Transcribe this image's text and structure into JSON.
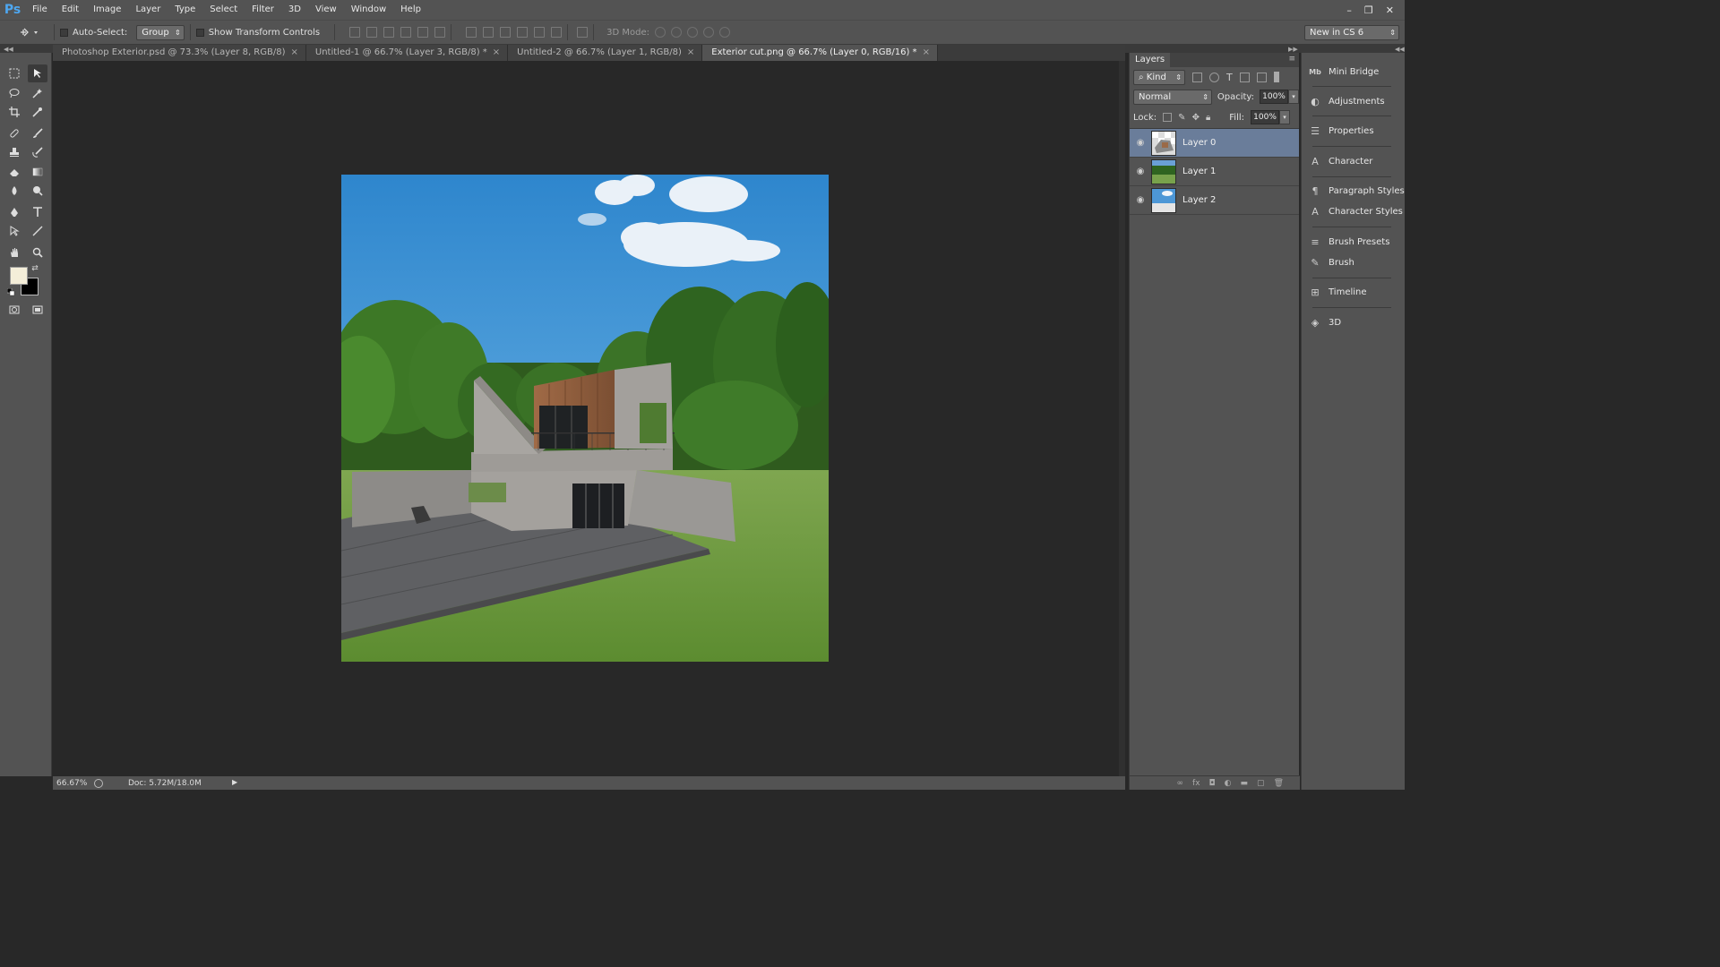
{
  "app": {
    "logo": "Ps",
    "menu": [
      "File",
      "Edit",
      "Image",
      "Layer",
      "Type",
      "Select",
      "Filter",
      "3D",
      "View",
      "Window",
      "Help"
    ],
    "window_controls": {
      "minimize": "–",
      "restore": "❐",
      "close": "✕"
    }
  },
  "options_bar": {
    "auto_select_label": "Auto-Select:",
    "auto_select_value": "Group",
    "show_transform_label": "Show Transform Controls",
    "mode_3d_label": "3D Mode:",
    "workspace": "New in CS 6"
  },
  "tabs": [
    {
      "label": "Photoshop Exterior.psd @ 73.3% (Layer 8, RGB/8)",
      "active": false
    },
    {
      "label": "Untitled-1 @ 66.7% (Layer 3, RGB/8) *",
      "active": false
    },
    {
      "label": "Untitled-2 @ 66.7% (Layer 1, RGB/8)",
      "active": false
    },
    {
      "label": "Exterior cut.png @ 66.7% (Layer 0, RGB/16) *",
      "active": true
    }
  ],
  "tab_close": "×",
  "status": {
    "zoom": "66.67%",
    "doc": "Doc: 5.72M/18.0M",
    "arrow": "▶"
  },
  "colors": {
    "foreground": "#f4eed9",
    "background": "#000000",
    "selected_layer": "#6a7d9a",
    "ps_blue": "#4ea7f0"
  },
  "layers_panel": {
    "tab": "Layers",
    "kind": "Kind",
    "blend_mode": "Normal",
    "opacity_label": "Opacity:",
    "opacity": "100%",
    "lock_label": "Lock:",
    "fill_label": "Fill:",
    "fill": "100%",
    "layers": [
      {
        "name": "Layer 0",
        "selected": true,
        "visible": true
      },
      {
        "name": "Layer 1",
        "selected": false,
        "visible": true
      },
      {
        "name": "Layer 2",
        "selected": false,
        "visible": true
      }
    ],
    "footer_icons": [
      "link-icon",
      "fx-icon",
      "mask-icon",
      "adjustment-icon",
      "folder-icon",
      "new-layer-icon",
      "trash-icon"
    ]
  },
  "dock": [
    {
      "label": "Mini Bridge",
      "icon": "Mb"
    },
    {
      "label": "Adjustments",
      "icon": "◐"
    },
    {
      "label": "Properties",
      "icon": "☰"
    },
    {
      "label": "Character",
      "icon": "A"
    },
    {
      "label": "Paragraph Styles",
      "icon": "¶"
    },
    {
      "label": "Character Styles",
      "icon": "A"
    },
    {
      "label": "Brush Presets",
      "icon": "≡"
    },
    {
      "label": "Brush",
      "icon": "✎"
    },
    {
      "label": "Timeline",
      "icon": "⊞"
    },
    {
      "label": "3D",
      "icon": "◈"
    }
  ]
}
